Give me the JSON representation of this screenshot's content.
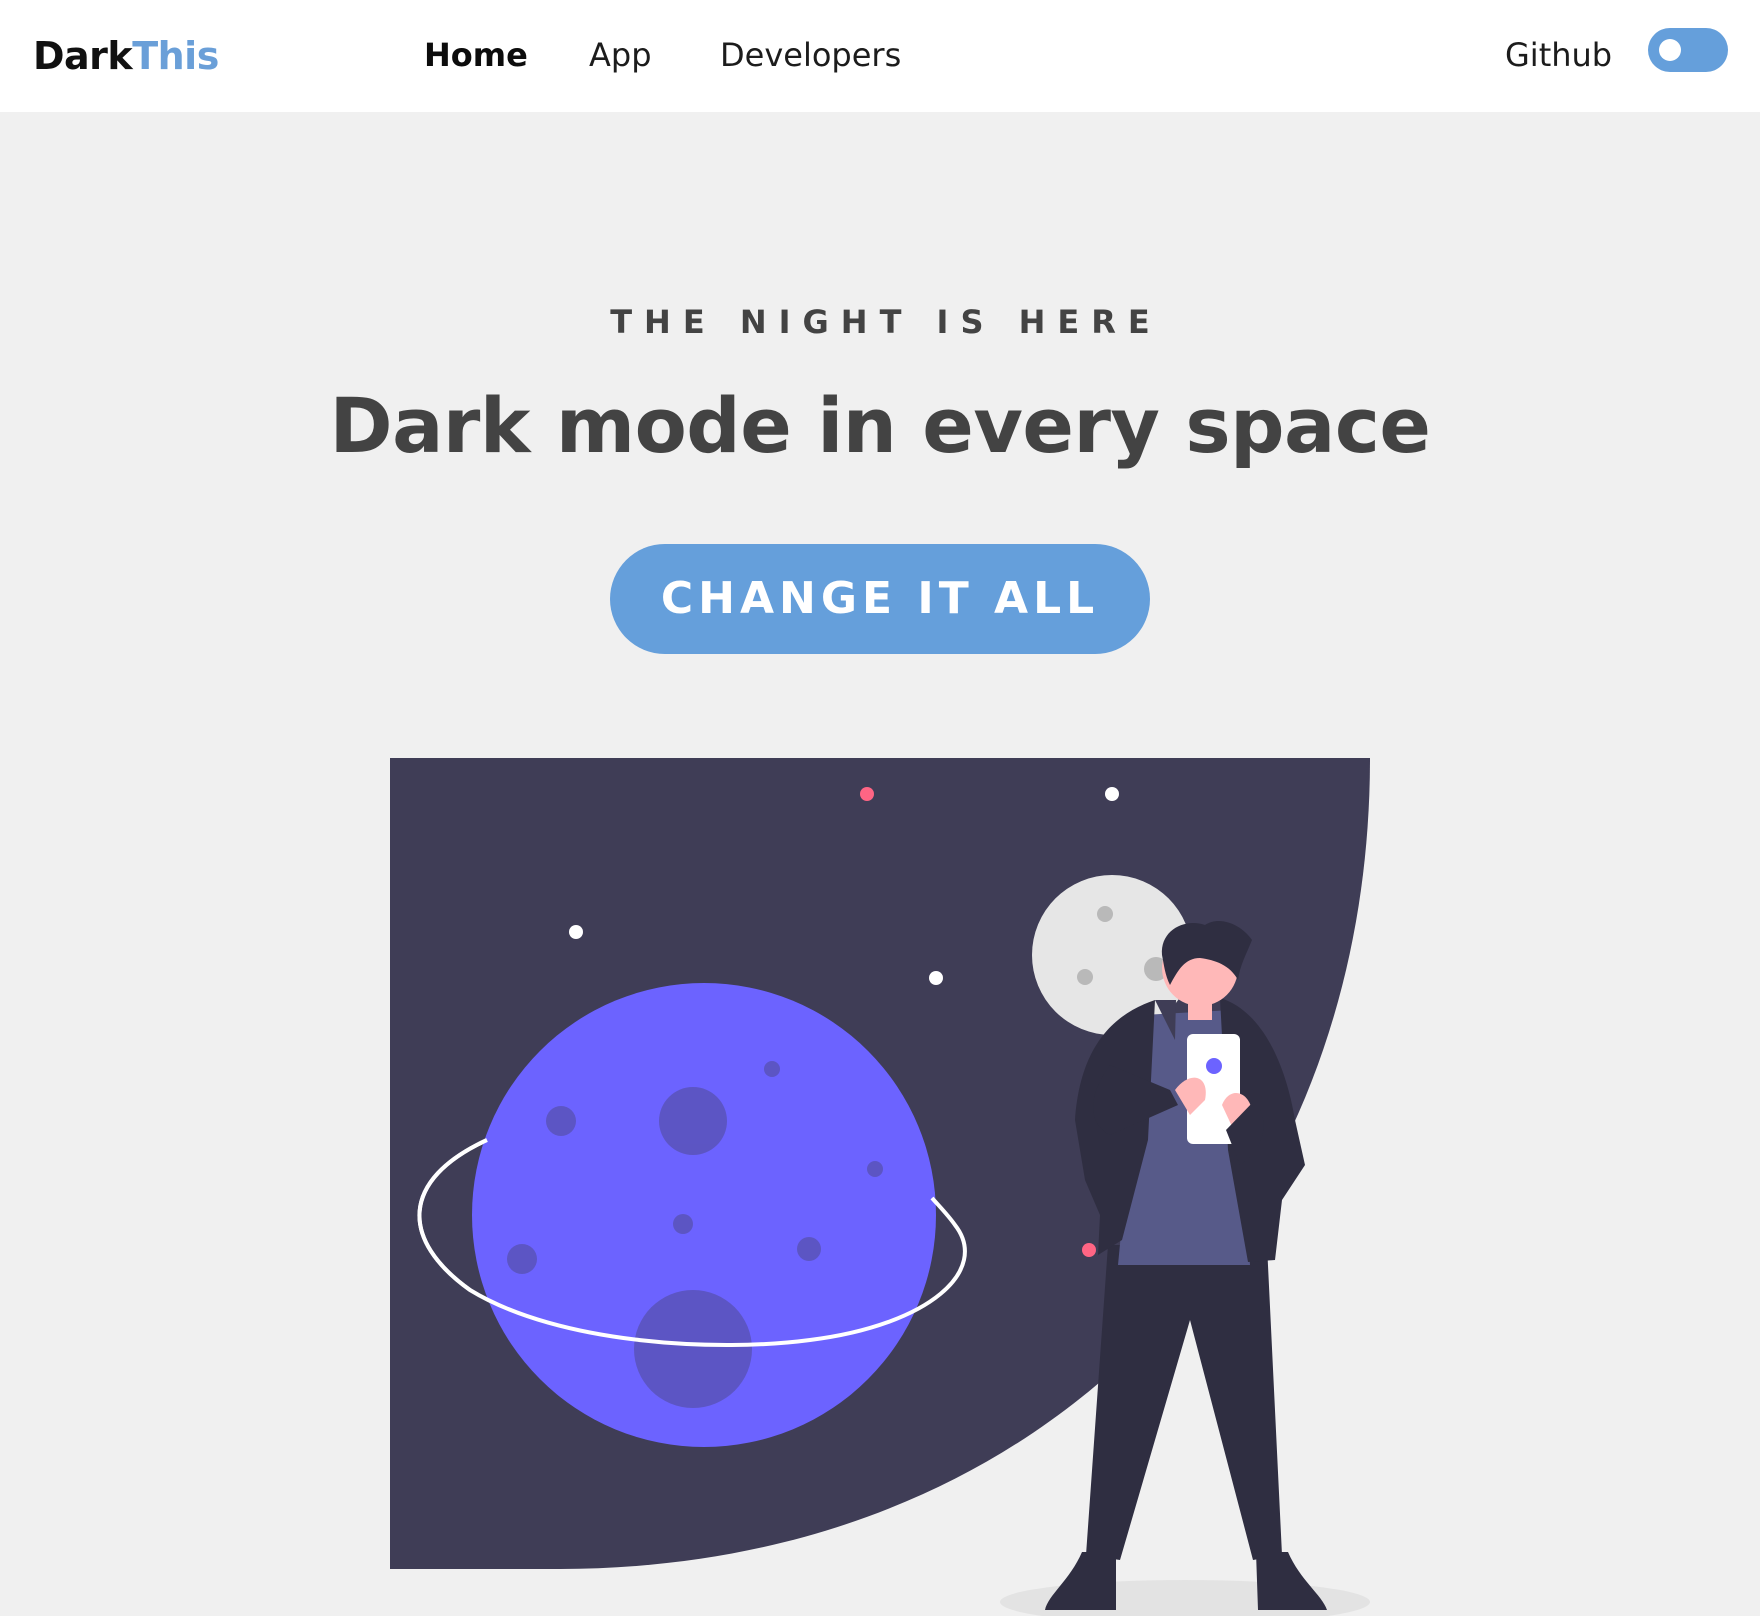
{
  "nav": {
    "logo_dark": "Dark",
    "logo_this": "This",
    "links": [
      "Home",
      "App",
      "Developers"
    ],
    "github": "Github",
    "theme_toggle_on": false
  },
  "hero": {
    "eyebrow": "THE NIGHT IS HERE",
    "headline": "Dark mode in every space",
    "cta": "CHANGE IT ALL"
  },
  "colors": {
    "accent": "#659fdb",
    "text": "#434343",
    "background": "#f0f0f0",
    "space": "#3f3d56",
    "planet": "#6c63ff",
    "star_pink": "#ff6584"
  },
  "icons": {
    "toggle": "theme-toggle-switch"
  }
}
